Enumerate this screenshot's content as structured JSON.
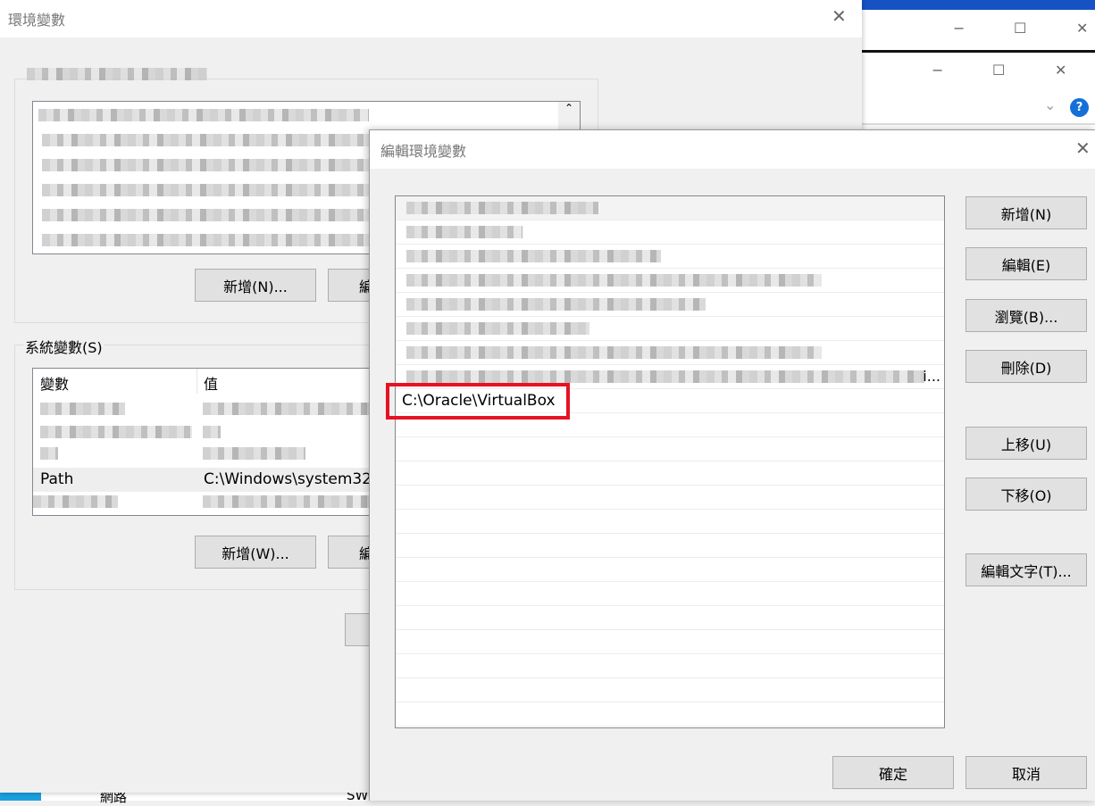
{
  "background": {
    "window_controls": {
      "minimize": "−",
      "maximize": "☐",
      "close": "✕"
    },
    "help_icon": "?",
    "taskbar": {
      "item1": "網路",
      "item2": "SW"
    }
  },
  "env_dialog": {
    "title": "環境變數",
    "user_vars": {
      "new_button": "新增(N)...",
      "edit_button_partial": "編"
    },
    "system_vars": {
      "label": "系統變數(S)",
      "columns": [
        "變數",
        "值"
      ],
      "rows": [
        {
          "name": "Path",
          "value": "C:\\Windows\\system32"
        }
      ],
      "new_button": "新增(W)...",
      "edit_button_partial": "編"
    }
  },
  "edit_dialog": {
    "title": "編輯環境變數",
    "entries_last_visible": "C:\\Oracle\\VirtualBox",
    "truncated_suffix": "i...",
    "buttons": {
      "new": "新增(N)",
      "edit": "編輯(E)",
      "browse": "瀏覽(B)...",
      "delete": "刪除(D)",
      "move_up": "上移(U)",
      "move_down": "下移(O)",
      "edit_text": "編輯文字(T)...",
      "ok": "確定",
      "cancel": "取消"
    },
    "highlight_color": "#e81123"
  }
}
